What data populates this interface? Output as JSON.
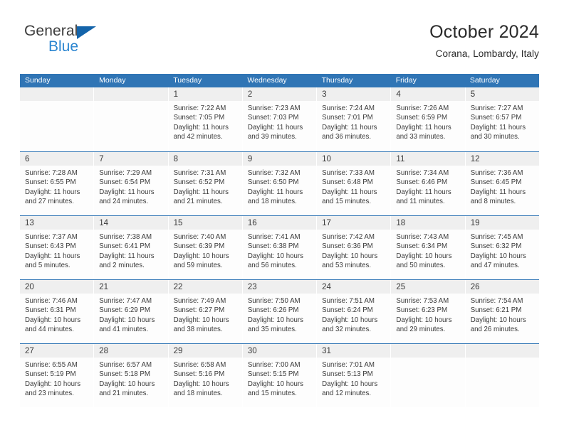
{
  "logo": {
    "word1": "General",
    "word2": "Blue",
    "triangle_color": "#1464aa",
    "blue_color": "#2a85d0"
  },
  "header": {
    "title": "October 2024",
    "subtitle": "Corana, Lombardy, Italy"
  },
  "theme": {
    "header_band": "#3075b5",
    "cell_head": "#efefef",
    "cell_bg": "#fdfdfd",
    "text": "#3a3a3a"
  },
  "weekdays": [
    "Sunday",
    "Monday",
    "Tuesday",
    "Wednesday",
    "Thursday",
    "Friday",
    "Saturday"
  ],
  "weeks": [
    [
      {
        "day": "",
        "sunrise": "",
        "sunset": "",
        "daylight1": "",
        "daylight2": ""
      },
      {
        "day": "",
        "sunrise": "",
        "sunset": "",
        "daylight1": "",
        "daylight2": ""
      },
      {
        "day": "1",
        "sunrise": "Sunrise: 7:22 AM",
        "sunset": "Sunset: 7:05 PM",
        "daylight1": "Daylight: 11 hours",
        "daylight2": "and 42 minutes."
      },
      {
        "day": "2",
        "sunrise": "Sunrise: 7:23 AM",
        "sunset": "Sunset: 7:03 PM",
        "daylight1": "Daylight: 11 hours",
        "daylight2": "and 39 minutes."
      },
      {
        "day": "3",
        "sunrise": "Sunrise: 7:24 AM",
        "sunset": "Sunset: 7:01 PM",
        "daylight1": "Daylight: 11 hours",
        "daylight2": "and 36 minutes."
      },
      {
        "day": "4",
        "sunrise": "Sunrise: 7:26 AM",
        "sunset": "Sunset: 6:59 PM",
        "daylight1": "Daylight: 11 hours",
        "daylight2": "and 33 minutes."
      },
      {
        "day": "5",
        "sunrise": "Sunrise: 7:27 AM",
        "sunset": "Sunset: 6:57 PM",
        "daylight1": "Daylight: 11 hours",
        "daylight2": "and 30 minutes."
      }
    ],
    [
      {
        "day": "6",
        "sunrise": "Sunrise: 7:28 AM",
        "sunset": "Sunset: 6:55 PM",
        "daylight1": "Daylight: 11 hours",
        "daylight2": "and 27 minutes."
      },
      {
        "day": "7",
        "sunrise": "Sunrise: 7:29 AM",
        "sunset": "Sunset: 6:54 PM",
        "daylight1": "Daylight: 11 hours",
        "daylight2": "and 24 minutes."
      },
      {
        "day": "8",
        "sunrise": "Sunrise: 7:31 AM",
        "sunset": "Sunset: 6:52 PM",
        "daylight1": "Daylight: 11 hours",
        "daylight2": "and 21 minutes."
      },
      {
        "day": "9",
        "sunrise": "Sunrise: 7:32 AM",
        "sunset": "Sunset: 6:50 PM",
        "daylight1": "Daylight: 11 hours",
        "daylight2": "and 18 minutes."
      },
      {
        "day": "10",
        "sunrise": "Sunrise: 7:33 AM",
        "sunset": "Sunset: 6:48 PM",
        "daylight1": "Daylight: 11 hours",
        "daylight2": "and 15 minutes."
      },
      {
        "day": "11",
        "sunrise": "Sunrise: 7:34 AM",
        "sunset": "Sunset: 6:46 PM",
        "daylight1": "Daylight: 11 hours",
        "daylight2": "and 11 minutes."
      },
      {
        "day": "12",
        "sunrise": "Sunrise: 7:36 AM",
        "sunset": "Sunset: 6:45 PM",
        "daylight1": "Daylight: 11 hours",
        "daylight2": "and 8 minutes."
      }
    ],
    [
      {
        "day": "13",
        "sunrise": "Sunrise: 7:37 AM",
        "sunset": "Sunset: 6:43 PM",
        "daylight1": "Daylight: 11 hours",
        "daylight2": "and 5 minutes."
      },
      {
        "day": "14",
        "sunrise": "Sunrise: 7:38 AM",
        "sunset": "Sunset: 6:41 PM",
        "daylight1": "Daylight: 11 hours",
        "daylight2": "and 2 minutes."
      },
      {
        "day": "15",
        "sunrise": "Sunrise: 7:40 AM",
        "sunset": "Sunset: 6:39 PM",
        "daylight1": "Daylight: 10 hours",
        "daylight2": "and 59 minutes."
      },
      {
        "day": "16",
        "sunrise": "Sunrise: 7:41 AM",
        "sunset": "Sunset: 6:38 PM",
        "daylight1": "Daylight: 10 hours",
        "daylight2": "and 56 minutes."
      },
      {
        "day": "17",
        "sunrise": "Sunrise: 7:42 AM",
        "sunset": "Sunset: 6:36 PM",
        "daylight1": "Daylight: 10 hours",
        "daylight2": "and 53 minutes."
      },
      {
        "day": "18",
        "sunrise": "Sunrise: 7:43 AM",
        "sunset": "Sunset: 6:34 PM",
        "daylight1": "Daylight: 10 hours",
        "daylight2": "and 50 minutes."
      },
      {
        "day": "19",
        "sunrise": "Sunrise: 7:45 AM",
        "sunset": "Sunset: 6:32 PM",
        "daylight1": "Daylight: 10 hours",
        "daylight2": "and 47 minutes."
      }
    ],
    [
      {
        "day": "20",
        "sunrise": "Sunrise: 7:46 AM",
        "sunset": "Sunset: 6:31 PM",
        "daylight1": "Daylight: 10 hours",
        "daylight2": "and 44 minutes."
      },
      {
        "day": "21",
        "sunrise": "Sunrise: 7:47 AM",
        "sunset": "Sunset: 6:29 PM",
        "daylight1": "Daylight: 10 hours",
        "daylight2": "and 41 minutes."
      },
      {
        "day": "22",
        "sunrise": "Sunrise: 7:49 AM",
        "sunset": "Sunset: 6:27 PM",
        "daylight1": "Daylight: 10 hours",
        "daylight2": "and 38 minutes."
      },
      {
        "day": "23",
        "sunrise": "Sunrise: 7:50 AM",
        "sunset": "Sunset: 6:26 PM",
        "daylight1": "Daylight: 10 hours",
        "daylight2": "and 35 minutes."
      },
      {
        "day": "24",
        "sunrise": "Sunrise: 7:51 AM",
        "sunset": "Sunset: 6:24 PM",
        "daylight1": "Daylight: 10 hours",
        "daylight2": "and 32 minutes."
      },
      {
        "day": "25",
        "sunrise": "Sunrise: 7:53 AM",
        "sunset": "Sunset: 6:23 PM",
        "daylight1": "Daylight: 10 hours",
        "daylight2": "and 29 minutes."
      },
      {
        "day": "26",
        "sunrise": "Sunrise: 7:54 AM",
        "sunset": "Sunset: 6:21 PM",
        "daylight1": "Daylight: 10 hours",
        "daylight2": "and 26 minutes."
      }
    ],
    [
      {
        "day": "27",
        "sunrise": "Sunrise: 6:55 AM",
        "sunset": "Sunset: 5:19 PM",
        "daylight1": "Daylight: 10 hours",
        "daylight2": "and 23 minutes."
      },
      {
        "day": "28",
        "sunrise": "Sunrise: 6:57 AM",
        "sunset": "Sunset: 5:18 PM",
        "daylight1": "Daylight: 10 hours",
        "daylight2": "and 21 minutes."
      },
      {
        "day": "29",
        "sunrise": "Sunrise: 6:58 AM",
        "sunset": "Sunset: 5:16 PM",
        "daylight1": "Daylight: 10 hours",
        "daylight2": "and 18 minutes."
      },
      {
        "day": "30",
        "sunrise": "Sunrise: 7:00 AM",
        "sunset": "Sunset: 5:15 PM",
        "daylight1": "Daylight: 10 hours",
        "daylight2": "and 15 minutes."
      },
      {
        "day": "31",
        "sunrise": "Sunrise: 7:01 AM",
        "sunset": "Sunset: 5:13 PM",
        "daylight1": "Daylight: 10 hours",
        "daylight2": "and 12 minutes."
      },
      {
        "day": "",
        "sunrise": "",
        "sunset": "",
        "daylight1": "",
        "daylight2": ""
      },
      {
        "day": "",
        "sunrise": "",
        "sunset": "",
        "daylight1": "",
        "daylight2": ""
      }
    ]
  ]
}
